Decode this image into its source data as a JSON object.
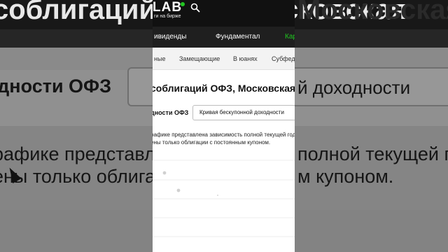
{
  "background": {
    "title_left": "соблигаций ОФЗ, Московская",
    "heading_left": "одности ОФЗ",
    "heading_right": "Кривая бескупонной доходности",
    "para1_left": "рафике представле",
    "para1_right": "полной текущей год",
    "para2_left": "ены только облига",
    "para2_right": "м купоном."
  },
  "header": {
    "logo": "LAB",
    "logo_sub": "ги на бирже",
    "accent": "#21c521"
  },
  "nav": {
    "items": [
      "ивиденды",
      "Фундаментал",
      "Кар"
    ]
  },
  "subtabs": {
    "items": [
      "ные",
      "Замещающие",
      "В юанях",
      "Субфед"
    ]
  },
  "content": {
    "title": "соблигаций ОФЗ, Московская",
    "field_label": "дности ОФЗ",
    "select_value": "Кривая бескупонной доходности",
    "desc_line1": "рафике представлена зависимость полной текущей год",
    "desc_line2": "ены только облигации с постоянным купоном."
  },
  "chart_data": {
    "type": "scatter",
    "points_visible": 3
  }
}
